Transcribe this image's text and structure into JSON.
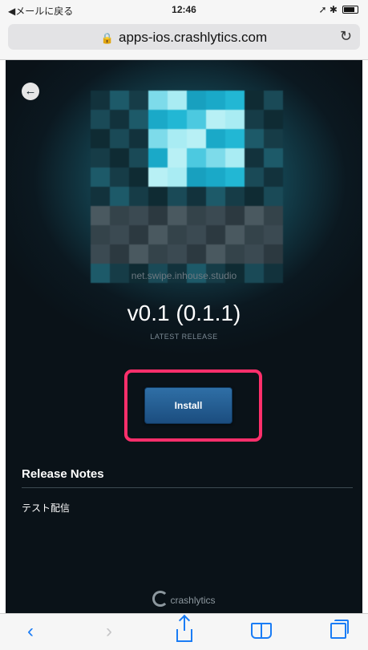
{
  "status_bar": {
    "back_label": "◀メールに戻る",
    "time": "12:46",
    "indicators": "➚ ✱"
  },
  "browser": {
    "url": "apps-ios.crashlytics.com",
    "lock_icon": "lock-icon",
    "reload_icon": "reload-icon"
  },
  "app": {
    "bundle_id": "net.swipe.inhouse.studio",
    "version": "v0.1 (0.1.1)",
    "release_label": "LATEST RELEASE",
    "install_label": "Install",
    "highlight_color": "#ff2f6b"
  },
  "release_notes": {
    "title": "Release Notes",
    "body": "テスト配信"
  },
  "footer": {
    "brand": "crashlytics"
  },
  "toolbar": {
    "back": "‹",
    "forward": "›",
    "accent": "#1a7cf5"
  }
}
